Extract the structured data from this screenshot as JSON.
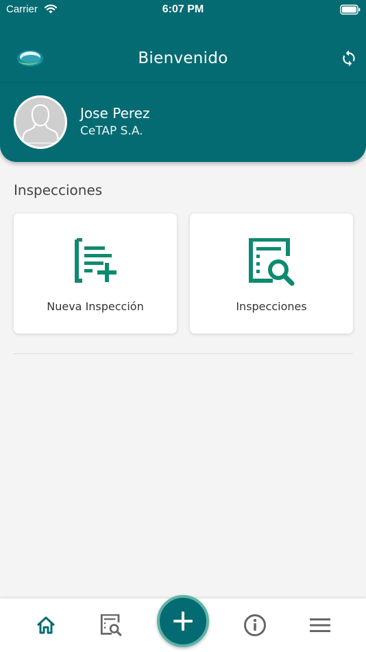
{
  "status_bar": {
    "carrier": "Carrier",
    "time": "6:07 PM"
  },
  "header": {
    "title": "Bienvenido"
  },
  "user": {
    "name": "Jose Perez",
    "company": "CeTAP S.A."
  },
  "section": {
    "title": "Inspecciones",
    "cards": [
      {
        "label": "Nueva Inspección",
        "icon": "new-inspection-icon"
      },
      {
        "label": "Inspecciones",
        "icon": "search-inspections-icon"
      }
    ]
  },
  "bottom_nav": {
    "items": [
      "home-icon",
      "search-inspections-icon",
      "add-icon",
      "info-icon",
      "menu-icon"
    ]
  },
  "colors": {
    "primary": "#056b72",
    "accent": "#0e8a70",
    "background": "#f4f4f4"
  }
}
